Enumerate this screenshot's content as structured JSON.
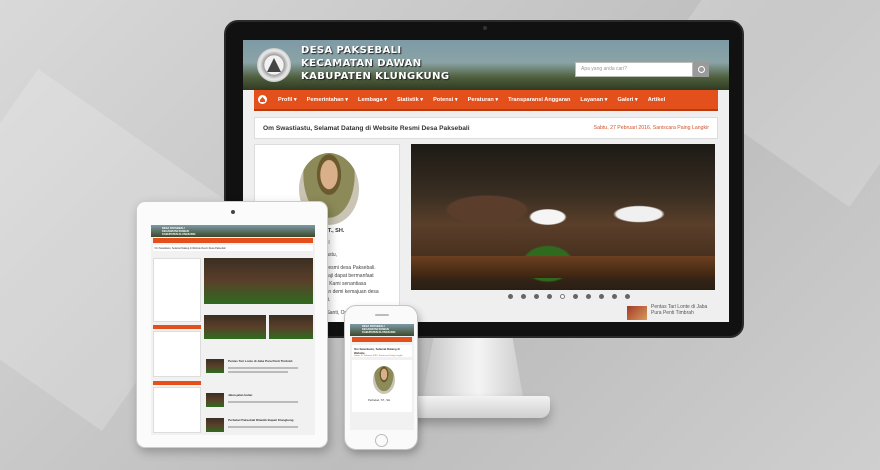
{
  "site": {
    "title_lines": [
      "DESA PAKSEBALI",
      "KECAMATAN DAWAN",
      "KABUPATEN KLUNGKUNG"
    ],
    "search_placeholder": "Apa yang anda cari?"
  },
  "nav": {
    "items": [
      "Profil ▾",
      "Pemerintahan ▾",
      "Lembaga ▾",
      "Statistik ▾",
      "Potensi ▾",
      "Peraturan ▾",
      "Transparansi Anggaran",
      "Layanan ▾",
      "Galeri ▾",
      "Artikel"
    ]
  },
  "welcome": {
    "text": "Om Swastiastu, Selamat Datang di Website Resmi Desa Paksebali",
    "date": "Sabtu, 27 Pebruari 2016, Saniscara Paing Langkir"
  },
  "profile": {
    "name": "...i, ST., SH.",
    "role": "...kel",
    "lines": [
      "...stiastu,",
      "...te resmi desa Paksebali.",
      "...arsaji dapat bermanfaat",
      "...ya. Kami senantiasa",
      "...aran demi kemajuan desa",
      "...bali.",
      "...ti, Santi, Om"
    ]
  },
  "slider": {
    "dot_count": 10,
    "active_dot": 4
  },
  "news": {
    "title": "Pentas Tari Lonte di Jaba Pura Penti Timbrah"
  },
  "tablet": {
    "header_lines": [
      "DESA PAKSEBALI",
      "KECAMATAN DAWAN",
      "KABUPATEN KLUNGKUNG"
    ],
    "welcome": "Om Swastiastu, Selamat Datang di Website Resmi Desa Paksebali",
    "news": [
      "Pentas Tari Lonte di Jaba Pura Penti Timbrah",
      "Jalan-jalan bulan",
      "Perbekel Paksebali Dilantik Bupati Klungkung"
    ]
  },
  "phone": {
    "header_lines": [
      "DESA PAKSEBALI",
      "KECAMATAN DAWAN",
      "KABUPATEN KLUNGKUNG"
    ],
    "welcome_a": "Om Swastiastu, Selamat Datang di Website",
    "welcome_b": "Sabtu, 27 Pebruari 2016, Saniscara Paing Langkir",
    "name": "Perbekel, ST., SH."
  },
  "colors": {
    "accent": "#e3501c",
    "date": "#d2542a"
  }
}
